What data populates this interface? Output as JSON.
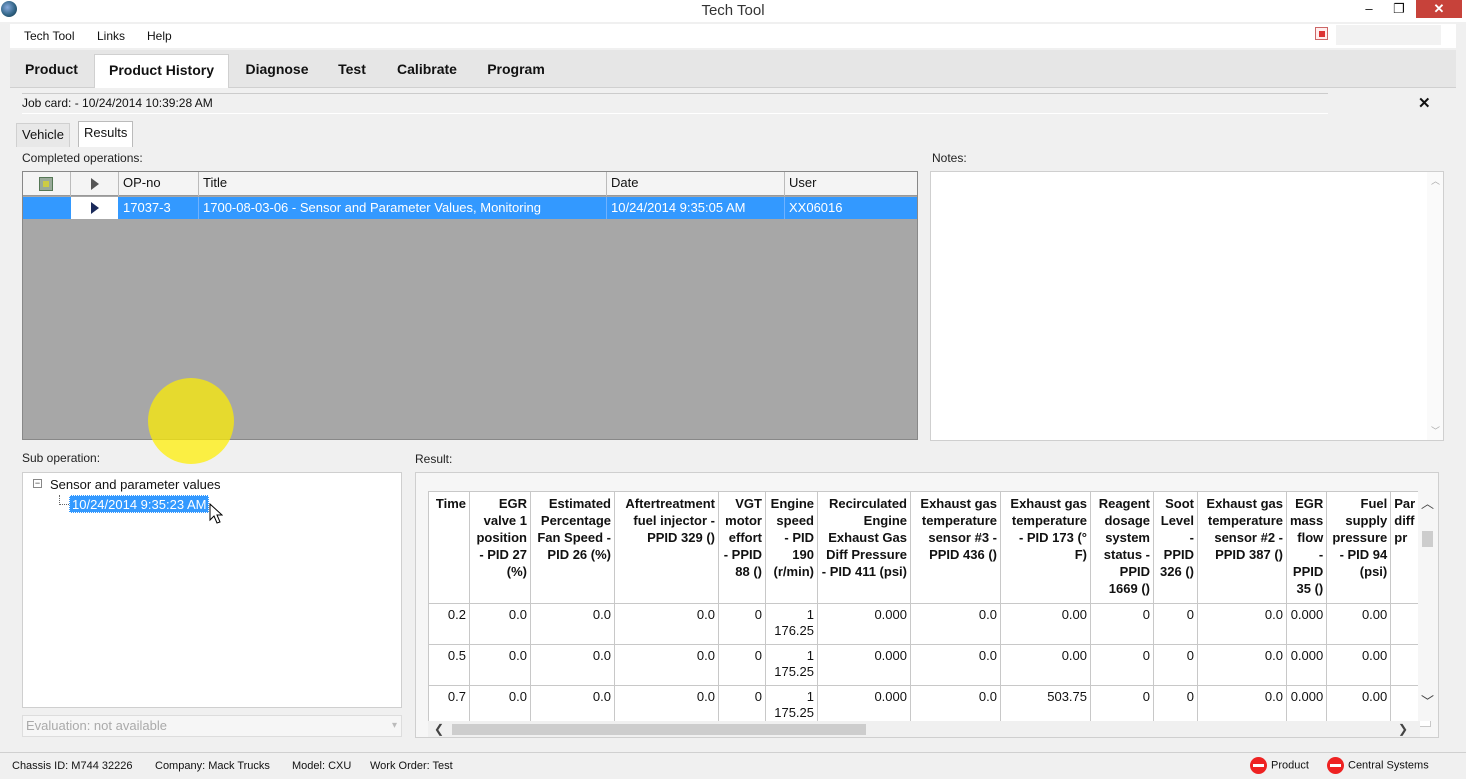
{
  "window": {
    "title": "Tech Tool",
    "min_glyph": "–",
    "max_glyph": "❐",
    "close_glyph": "✕"
  },
  "menu": {
    "items": [
      "Tech Tool",
      "Links",
      "Help"
    ]
  },
  "main_tabs": [
    "Product",
    "Product History",
    "Diagnose",
    "Test",
    "Calibrate",
    "Program"
  ],
  "active_main_tab": "Product History",
  "job_card": "Job card: -  10/24/2014 10:39:28 AM",
  "close_glyph": "✕",
  "sub_tabs": [
    "Vehicle",
    "Results"
  ],
  "completed_operations": {
    "label": "Completed operations:",
    "columns": [
      "OP-no",
      "Title",
      "Date",
      "User"
    ],
    "rows": [
      {
        "op_no": "17037-3",
        "title": "1700-08-03-06 - Sensor and Parameter Values, Monitoring",
        "date": "10/24/2014 9:35:05 AM",
        "user": "XX06016"
      }
    ]
  },
  "notes": {
    "label": "Notes:",
    "arrow_up": "︿",
    "arrow_down": "﹀"
  },
  "sub_operation": {
    "label": "Sub operation:",
    "expand_glyph": "−",
    "root": "Sensor and parameter values",
    "child": "10/24/2014 9:35:23 AM"
  },
  "evaluation": {
    "value": "Evaluation: not available",
    "arrow": "▾"
  },
  "result": {
    "label": "Result:",
    "columns": [
      "Time",
      "EGR valve 1 position - PID 27 (%)",
      "Estimated Percentage Fan Speed - PID 26 (%)",
      "Aftertreatment fuel injector - PPID 329 ()",
      "VGT motor effort - PPID 88 ()",
      "Engine speed - PID 190 (r/min)",
      "Recirculated Engine Exhaust Gas Diff Pressure - PID 411 (psi)",
      "Exhaust gas temperature sensor #3 - PPID 436 ()",
      "Exhaust gas temperature - PID 173 (° F)",
      "Reagent dosage system status - PPID 1669 ()",
      "Soot Level - PPID 326 ()",
      "Exhaust gas temperature sensor #2 - PPID 387 ()",
      "EGR mass flow - PPID 35 ()",
      "Fuel supply pressure - PID 94 (psi)",
      "Par diff pr"
    ],
    "rows": [
      [
        "0.2",
        "0.0",
        "0.0",
        "0.0",
        "0",
        "1 176.25",
        "0.000",
        "0.0",
        "0.00",
        "0",
        "0",
        "0.0",
        "0.000",
        "0.00",
        ""
      ],
      [
        "0.5",
        "0.0",
        "0.0",
        "0.0",
        "0",
        "1 175.25",
        "0.000",
        "0.0",
        "0.00",
        "0",
        "0",
        "0.0",
        "0.000",
        "0.00",
        ""
      ],
      [
        "0.7",
        "0.0",
        "0.0",
        "0.0",
        "0",
        "1 175.25",
        "0.000",
        "0.0",
        "503.75",
        "0",
        "0",
        "0.0",
        "0.000",
        "0.00",
        ""
      ]
    ],
    "scroll_left": "❮",
    "scroll_right": "❯",
    "scroll_up": "︿",
    "scroll_down": "﹀"
  },
  "status_bar": {
    "chassis": "Chassis ID: M744 32226",
    "company": "Company: Mack Trucks",
    "model": "Model: CXU",
    "work_order": "Work Order: Test",
    "product_status": "Product",
    "central_status": "Central Systems"
  }
}
